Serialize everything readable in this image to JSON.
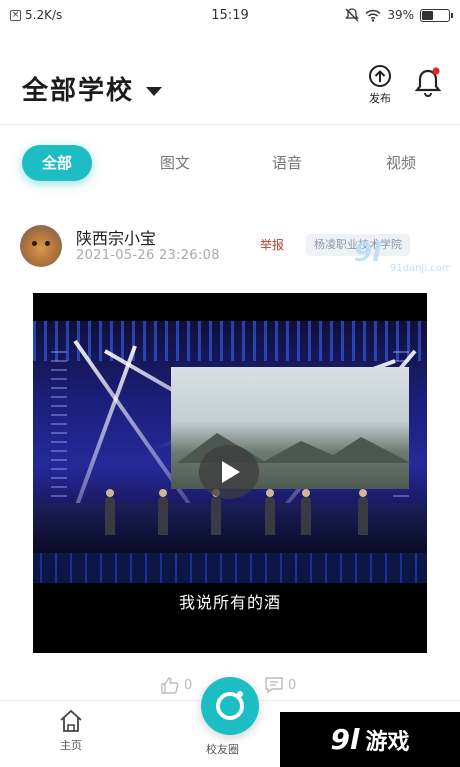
{
  "status_bar": {
    "net_speed": "5.2K/s",
    "time": "15:19",
    "battery": "39%",
    "battery_level": 0.39
  },
  "header": {
    "title": "全部学校",
    "publish_label": "发布"
  },
  "tabs": [
    {
      "label": "全部",
      "active": true
    },
    {
      "label": "图文",
      "active": false
    },
    {
      "label": "语音",
      "active": false
    },
    {
      "label": "视频",
      "active": false
    }
  ],
  "post": {
    "author": "陕西宗小宝",
    "time": "2021-05-26 23:26:08",
    "report_label": "举报",
    "school_tag": "杨凌职业技术学院",
    "video_subtitle": "我说所有的酒",
    "likes": "0",
    "comments": "0"
  },
  "bottom_nav": {
    "home_label": "主页",
    "circle_label": "校友圈"
  },
  "watermark": {
    "top_text": "91danji.com",
    "logo": "9l",
    "text": "游戏"
  },
  "colors": {
    "accent": "#1dbdc4",
    "report": "#c0392b",
    "notification_dot": "#e8262a"
  }
}
